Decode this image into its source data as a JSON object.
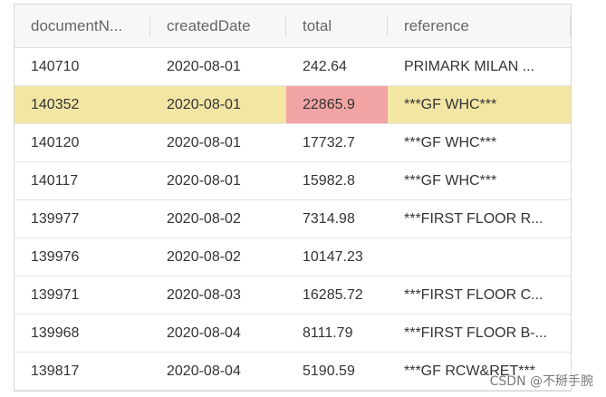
{
  "table": {
    "columns": [
      "documentN...",
      "createdDate",
      "total",
      "reference"
    ],
    "rows": [
      [
        "140710",
        "2020-08-01",
        "242.64",
        "PRIMARK MILAN ..."
      ],
      [
        "140352",
        "2020-08-01",
        "22865.9",
        "***GF WHC***"
      ],
      [
        "140120",
        "2020-08-01",
        "17732.7",
        "***GF WHC***"
      ],
      [
        "140117",
        "2020-08-01",
        "15982.8",
        "***GF WHC***"
      ],
      [
        "139977",
        "2020-08-02",
        "7314.98",
        "***FIRST FLOOR R..."
      ],
      [
        "139976",
        "2020-08-02",
        "10147.23",
        ""
      ],
      [
        "139971",
        "2020-08-03",
        "16285.72",
        "***FIRST FLOOR C..."
      ],
      [
        "139968",
        "2020-08-04",
        "8111.79",
        "***FIRST FLOOR B-..."
      ],
      [
        "139817",
        "2020-08-04",
        "5190.59",
        "***GF RCW&RET***"
      ]
    ],
    "selected_row_index": 1,
    "highlight_cell": {
      "row": 1,
      "column": 2
    },
    "colors": {
      "selected_row": "#f3e6a4",
      "highlight_cell": "#f2a3a3",
      "header_bg": "#f7f7f7",
      "text": "#333333"
    }
  },
  "watermark": "CSDN @不掰手腕"
}
